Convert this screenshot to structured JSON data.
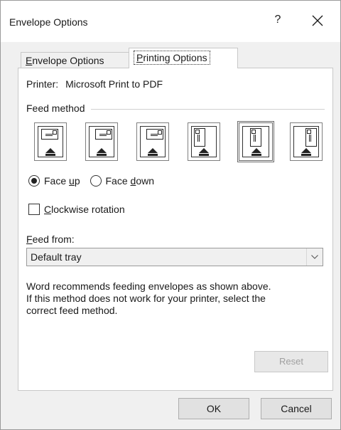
{
  "window": {
    "title": "Envelope Options",
    "help": "?",
    "close_icon": "close-icon"
  },
  "tabs": [
    {
      "label_pre": "",
      "label_ul": "E",
      "label_post": "nvelope Options",
      "active": false
    },
    {
      "label_pre": "",
      "label_ul": "P",
      "label_post": "rinting Options",
      "active": true
    }
  ],
  "printer": {
    "label": "Printer:",
    "value": "Microsoft Print to PDF"
  },
  "feed_method": {
    "label": "Feed method",
    "options_count_label": "",
    "selected_index": 4
  },
  "orientation": {
    "face_up_pre": "Face ",
    "face_up_ul": "u",
    "face_up_post": "p",
    "face_down_pre": "Face ",
    "face_down_ul": "d",
    "face_down_post": "own",
    "selected": "face_up"
  },
  "rotation": {
    "ul": "C",
    "post": "lockwise rotation",
    "checked": false
  },
  "feed_from": {
    "label_ul": "F",
    "label_post": "eed from:",
    "value": "Default tray"
  },
  "note": {
    "line1": "Word recommends feeding envelopes as shown above.",
    "line2": "If this method does not work for your printer, select the",
    "line3": "correct feed method."
  },
  "buttons": {
    "reset": "Reset",
    "ok": "OK",
    "cancel": "Cancel"
  }
}
